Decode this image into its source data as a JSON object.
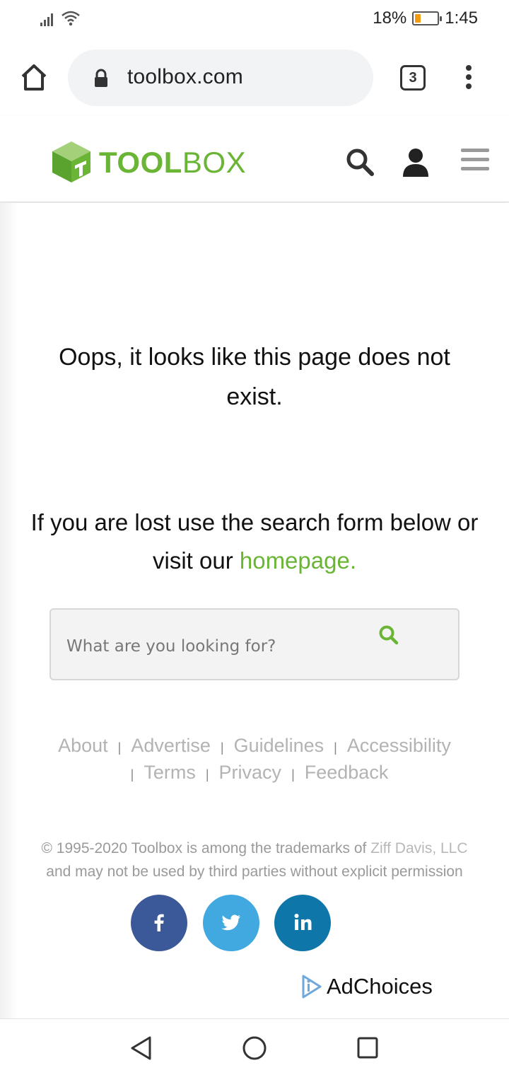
{
  "status_bar": {
    "battery_percent": "18%",
    "time": "1:45",
    "icons": [
      "signal-icon",
      "wifi-icon",
      "battery-icon"
    ]
  },
  "browser": {
    "url": "toolbox.com",
    "tab_count": "3",
    "load_progress": 0.475,
    "accent_color": "#1a73e8"
  },
  "site_header": {
    "logo_bold": "TOOL",
    "logo_light": "BOX",
    "brand_color": "#6bb536",
    "icons": [
      "search-icon",
      "user-icon",
      "hamburger-icon"
    ]
  },
  "main": {
    "oops_message": "Oops, it looks like this page does not exist.",
    "lost_text": "If you are lost use the search form below or visit our",
    "homepage_link": "homepage.",
    "search_placeholder": "What are you looking for?"
  },
  "footer": {
    "links": [
      "About",
      "Advertise",
      "Guidelines",
      "Accessibility",
      "Terms",
      "Privacy",
      "Feedback"
    ],
    "separator": "|",
    "copyright_prefix": "© 1995-2020 Toolbox is among the trademarks of",
    "copyright_link": "Ziff Davis, LLC",
    "copyright_suffix": "and may not be used by third parties without explicit permission",
    "social": [
      {
        "name": "facebook",
        "color": "#3b5998"
      },
      {
        "name": "twitter",
        "color": "#41a9e0"
      },
      {
        "name": "linkedin",
        "color": "#0e76a8"
      }
    ],
    "adchoices": "AdChoices"
  },
  "nav_bar": {
    "icons": [
      "back-icon",
      "home-icon",
      "recents-icon"
    ]
  }
}
